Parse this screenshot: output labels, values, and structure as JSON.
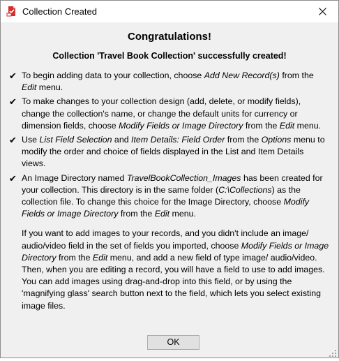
{
  "window": {
    "title": "Collection Created"
  },
  "dialog": {
    "heading": "Congratulations!",
    "subheading": "Collection 'Travel Book Collection' successfully created!",
    "bullets": [
      {
        "mark": "✔",
        "segments": [
          {
            "t": "To begin adding data to your collection, choose ",
            "i": false
          },
          {
            "t": "Add New Record(s)",
            "i": true
          },
          {
            "t": " from the ",
            "i": false
          },
          {
            "t": "Edit",
            "i": true
          },
          {
            "t": " menu.",
            "i": false
          }
        ]
      },
      {
        "mark": "✔",
        "segments": [
          {
            "t": "To make changes to your collection design (add, delete, or modify fields), change the collection's name, or change the default units for currency or dimension fields, choose ",
            "i": false
          },
          {
            "t": "Modify Fields or Image Directory",
            "i": true
          },
          {
            "t": " from the ",
            "i": false
          },
          {
            "t": "Edit",
            "i": true
          },
          {
            "t": " menu.",
            "i": false
          }
        ]
      },
      {
        "mark": "✔",
        "segments": [
          {
            "t": "Use ",
            "i": false
          },
          {
            "t": "List Field Selection",
            "i": true
          },
          {
            "t": " and ",
            "i": false
          },
          {
            "t": "Item Details: Field Order",
            "i": true
          },
          {
            "t": " from the ",
            "i": false
          },
          {
            "t": "Options",
            "i": true
          },
          {
            "t": " menu to modify the order and choice of fields displayed in the List and Item Details views.",
            "i": false
          }
        ]
      },
      {
        "mark": "✔",
        "segments": [
          {
            "t": "An Image Directory named ",
            "i": false
          },
          {
            "t": "TravelBookCollection_Images",
            "i": true
          },
          {
            "t": " has been created for your collection. This directory is in the same folder (",
            "i": false
          },
          {
            "t": "C:\\Collections",
            "i": true
          },
          {
            "t": ") as the collection file. To change this choice for the Image Directory, choose ",
            "i": false
          },
          {
            "t": "Modify Fields or Image Directory",
            "i": true
          },
          {
            "t": " from the ",
            "i": false
          },
          {
            "t": "Edit",
            "i": true
          },
          {
            "t": " menu.",
            "i": false
          }
        ]
      }
    ],
    "note": [
      {
        "t": "If you want to add images to your records, and you didn't include an image/ audio/video field in the set of fields you imported, choose ",
        "i": false
      },
      {
        "t": "Modify Fields or Image Directory",
        "i": true
      },
      {
        "t": " from the ",
        "i": false
      },
      {
        "t": "Edit",
        "i": true
      },
      {
        "t": " menu, and add a new field of type image/ audio/video. Then, when you are editing a record, you will have a field to use to add images. You can add images using drag-and-drop into this field, or by using the 'magnifying glass' search button next to the field, which lets you select existing image files.",
        "i": false
      }
    ],
    "ok_label": "OK"
  },
  "icons": {
    "app": "collection-app-icon",
    "close": "close-icon",
    "check": "checkmark-icon",
    "grip": "resize-grip-icon"
  },
  "colors": {
    "dialog_bg": "#f0f0f0",
    "titlebar_bg": "#ffffff",
    "app_icon_red": "#d32f2f",
    "button_bg": "#e1e1e1",
    "button_border": "#adadad"
  }
}
